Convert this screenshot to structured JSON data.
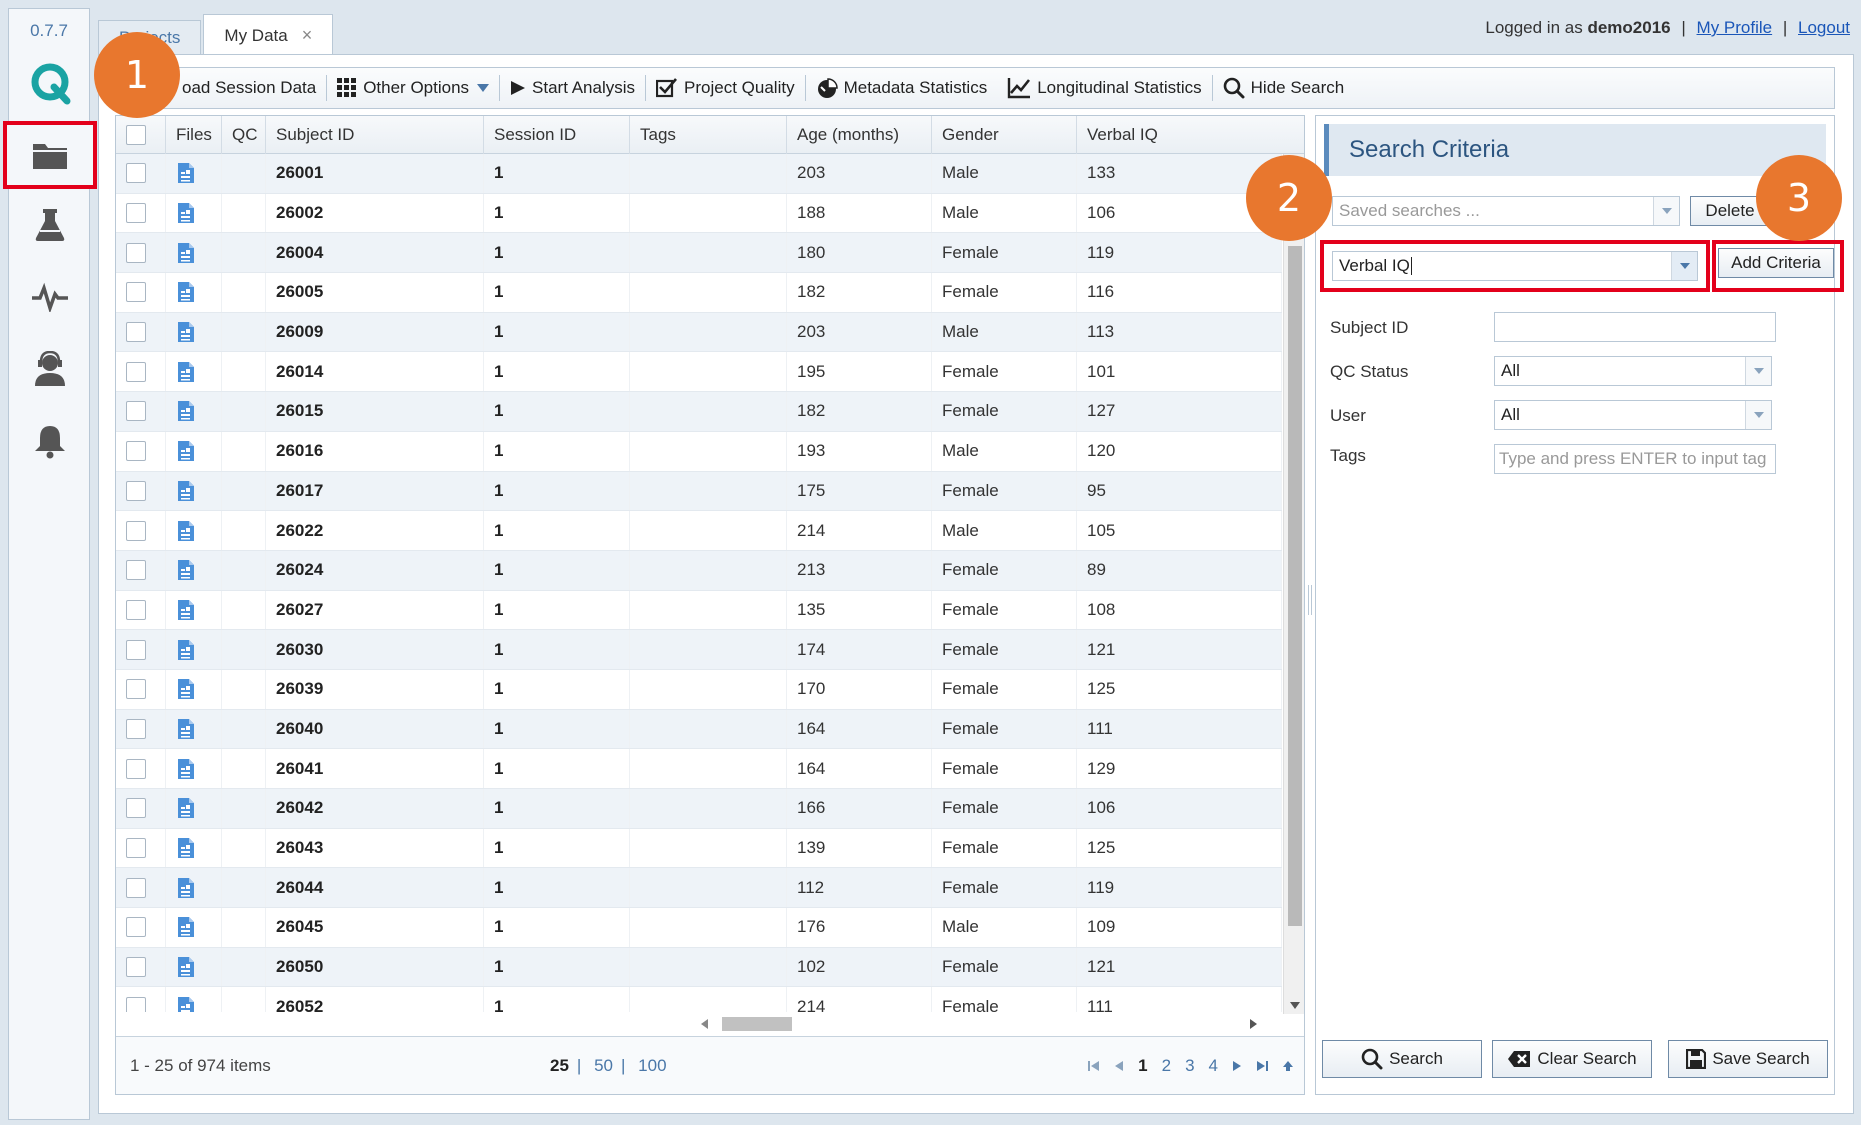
{
  "app": {
    "version": "0.7.7",
    "logo_letter": "Q"
  },
  "rail": {
    "items": [
      {
        "icon": "folder-icon",
        "selected": true
      },
      {
        "icon": "flask-icon",
        "selected": false
      },
      {
        "icon": "pulse-icon",
        "selected": false
      },
      {
        "icon": "support-agent-icon",
        "selected": false
      },
      {
        "icon": "bell-icon",
        "selected": false
      }
    ]
  },
  "tabs": [
    {
      "label": "Projects",
      "active": false
    },
    {
      "label": "My Data",
      "active": true,
      "close": "×"
    }
  ],
  "login": {
    "prefix": "Logged in as",
    "user": "demo2016",
    "sep": "|",
    "profile": "My Profile",
    "logout": "Logout"
  },
  "toolbar": {
    "load": "oad Session Data",
    "other": "Other Options",
    "start": "Start Analysis",
    "quality": "Project Quality",
    "metadata": "Metadata Statistics",
    "longitudinal": "Longitudinal Statistics",
    "hide": "Hide Search"
  },
  "grid": {
    "columns": [
      "Files",
      "QC",
      "Subject ID",
      "Session ID",
      "Tags",
      "Age (months)",
      "Gender",
      "Verbal IQ"
    ],
    "rows": [
      [
        "26001",
        "1",
        "203",
        "Male",
        "133"
      ],
      [
        "26002",
        "1",
        "188",
        "Male",
        "106"
      ],
      [
        "26004",
        "1",
        "180",
        "Female",
        "119"
      ],
      [
        "26005",
        "1",
        "182",
        "Female",
        "116"
      ],
      [
        "26009",
        "1",
        "203",
        "Male",
        "113"
      ],
      [
        "26014",
        "1",
        "195",
        "Female",
        "101"
      ],
      [
        "26015",
        "1",
        "182",
        "Female",
        "127"
      ],
      [
        "26016",
        "1",
        "193",
        "Male",
        "120"
      ],
      [
        "26017",
        "1",
        "175",
        "Female",
        "95"
      ],
      [
        "26022",
        "1",
        "214",
        "Male",
        "105"
      ],
      [
        "26024",
        "1",
        "213",
        "Female",
        "89"
      ],
      [
        "26027",
        "1",
        "135",
        "Female",
        "108"
      ],
      [
        "26030",
        "1",
        "174",
        "Female",
        "121"
      ],
      [
        "26039",
        "1",
        "170",
        "Female",
        "125"
      ],
      [
        "26040",
        "1",
        "164",
        "Female",
        "111"
      ],
      [
        "26041",
        "1",
        "164",
        "Female",
        "129"
      ],
      [
        "26042",
        "1",
        "166",
        "Female",
        "106"
      ],
      [
        "26043",
        "1",
        "139",
        "Female",
        "125"
      ],
      [
        "26044",
        "1",
        "112",
        "Female",
        "119"
      ],
      [
        "26045",
        "1",
        "176",
        "Male",
        "109"
      ],
      [
        "26050",
        "1",
        "102",
        "Female",
        "121"
      ],
      [
        "26052",
        "1",
        "214",
        "Female",
        "111"
      ]
    ],
    "pager": {
      "info": "1 - 25 of 974 items",
      "sizes": [
        "25",
        "50",
        "100"
      ],
      "pages": [
        "1",
        "2",
        "3",
        "4"
      ]
    }
  },
  "search": {
    "title": "Search Criteria",
    "saved_placeholder": "Saved searches ...",
    "delete": "Delete",
    "criteria_value": "Verbal IQ",
    "add_criteria": "Add Criteria",
    "fields": {
      "subject_id": "Subject ID",
      "qc_status": "QC Status",
      "qc_value": "All",
      "user": "User",
      "user_value": "All",
      "tags": "Tags",
      "tags_placeholder": "Type and press ENTER to input tag"
    },
    "buttons": {
      "search": "Search",
      "clear": "Clear Search",
      "save": "Save Search"
    }
  },
  "callouts": [
    "1",
    "2",
    "3"
  ],
  "colors": {
    "accent": "#4a77a8",
    "callout": "#e8772e",
    "highlight": "#e3001b",
    "file_icon": "#4a90d9"
  }
}
